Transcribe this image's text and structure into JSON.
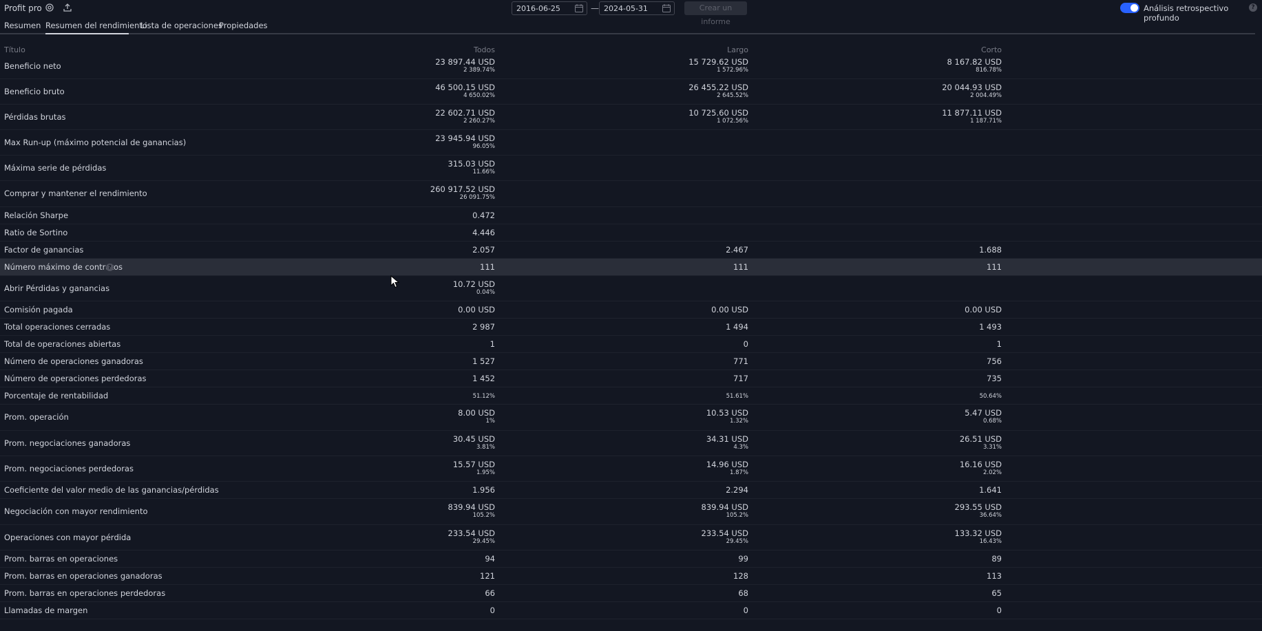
{
  "header": {
    "title": "Profit pro",
    "start_date": "2016-06-25",
    "end_date": "2024-05-31",
    "date_separator": "—",
    "create_report": "Crear un informe",
    "deep_backtest_label": "Análisis retrospectivo profundo",
    "deep_backtest_on": true
  },
  "tabs": [
    "Resumen",
    "Resumen del rendimiento",
    "Lista de operaciones",
    "Propiedades"
  ],
  "active_tab": "Resumen del rendimiento",
  "columns": {
    "title": "Título",
    "all": "Todos",
    "long": "Largo",
    "short": "Corto"
  },
  "rows": [
    {
      "label": "Beneficio neto",
      "all": [
        "23 897.44 USD",
        "2 389.74%"
      ],
      "long": [
        "15 729.62 USD",
        "1 572.96%"
      ],
      "short": [
        "8 167.82 USD",
        "816.78%"
      ]
    },
    {
      "label": "Beneficio bruto",
      "all": [
        "46 500.15 USD",
        "4 650.02%"
      ],
      "long": [
        "26 455.22 USD",
        "2 645.52%"
      ],
      "short": [
        "20 044.93 USD",
        "2 004.49%"
      ]
    },
    {
      "label": "Pérdidas brutas",
      "all": [
        "22 602.71 USD",
        "2 260.27%"
      ],
      "long": [
        "10 725.60 USD",
        "1 072.56%"
      ],
      "short": [
        "11 877.11 USD",
        "1 187.71%"
      ]
    },
    {
      "label": "Max Run-up (máximo potencial de ganancias)",
      "all": [
        "23 945.94 USD",
        "96.05%"
      ],
      "long": [],
      "short": []
    },
    {
      "label": "Máxima serie de pérdidas",
      "all": [
        "315.03 USD",
        "11.66%"
      ],
      "long": [],
      "short": []
    },
    {
      "label": "Comprar y mantener el rendimiento",
      "all": [
        "260 917.52 USD",
        "26 091.75%"
      ],
      "long": [],
      "short": []
    },
    {
      "label": "Relación Sharpe",
      "all": [
        "0.472"
      ],
      "long": [],
      "short": []
    },
    {
      "label": "Ratio de Sortino",
      "all": [
        "4.446"
      ],
      "long": [],
      "short": []
    },
    {
      "label": "Factor de ganancias",
      "all": [
        "2.057"
      ],
      "long": [
        "2.467"
      ],
      "short": [
        "1.688"
      ]
    },
    {
      "label": "Número máximo de contratos",
      "all": [
        "111"
      ],
      "long": [
        "111"
      ],
      "short": [
        "111"
      ],
      "help": true,
      "highlight": true
    },
    {
      "label": "Abrir Pérdidas y ganancias",
      "all": [
        "10.72 USD",
        "0.04%"
      ],
      "long": [],
      "short": []
    },
    {
      "label": "Comisión pagada",
      "all": [
        "0.00 USD"
      ],
      "long": [
        "0.00 USD"
      ],
      "short": [
        "0.00 USD"
      ]
    },
    {
      "label": "Total operaciones cerradas",
      "all": [
        "2 987"
      ],
      "long": [
        "1 494"
      ],
      "short": [
        "1 493"
      ]
    },
    {
      "label": "Total de operaciones abiertas",
      "all": [
        "1"
      ],
      "long": [
        "0"
      ],
      "short": [
        "1"
      ]
    },
    {
      "label": "Número de operaciones ganadoras",
      "all": [
        "1 527"
      ],
      "long": [
        "771"
      ],
      "short": [
        "756"
      ]
    },
    {
      "label": "Número de operaciones perdedoras",
      "all": [
        "1 452"
      ],
      "long": [
        "717"
      ],
      "short": [
        "735"
      ]
    },
    {
      "label": "Porcentaje de rentabilidad",
      "all": [
        "",
        "51.12%"
      ],
      "long": [
        "",
        "51.61%"
      ],
      "short": [
        "",
        "50.64%"
      ]
    },
    {
      "label": "Prom. operación",
      "all": [
        "8.00 USD",
        "1%"
      ],
      "long": [
        "10.53 USD",
        "1.32%"
      ],
      "short": [
        "5.47 USD",
        "0.68%"
      ]
    },
    {
      "label": "Prom. negociaciones ganadoras",
      "all": [
        "30.45 USD",
        "3.81%"
      ],
      "long": [
        "34.31 USD",
        "4.3%"
      ],
      "short": [
        "26.51 USD",
        "3.31%"
      ]
    },
    {
      "label": "Prom. negociaciones perdedoras",
      "all": [
        "15.57 USD",
        "1.95%"
      ],
      "long": [
        "14.96 USD",
        "1.87%"
      ],
      "short": [
        "16.16 USD",
        "2.02%"
      ]
    },
    {
      "label": "Coeficiente del valor medio de las ganancias/pérdidas",
      "all": [
        "1.956"
      ],
      "long": [
        "2.294"
      ],
      "short": [
        "1.641"
      ]
    },
    {
      "label": "Negociación con mayor rendimiento",
      "all": [
        "839.94 USD",
        "105.2%"
      ],
      "long": [
        "839.94 USD",
        "105.2%"
      ],
      "short": [
        "293.55 USD",
        "36.64%"
      ]
    },
    {
      "label": "Operaciones con mayor pérdida",
      "all": [
        "233.54 USD",
        "29.45%"
      ],
      "long": [
        "233.54 USD",
        "29.45%"
      ],
      "short": [
        "133.32 USD",
        "16.43%"
      ]
    },
    {
      "label": "Prom. barras en operaciones",
      "all": [
        "94"
      ],
      "long": [
        "99"
      ],
      "short": [
        "89"
      ]
    },
    {
      "label": "Prom. barras en operaciones ganadoras",
      "all": [
        "121"
      ],
      "long": [
        "128"
      ],
      "short": [
        "113"
      ]
    },
    {
      "label": "Prom. barras en operaciones perdedoras",
      "all": [
        "66"
      ],
      "long": [
        "68"
      ],
      "short": [
        "65"
      ]
    },
    {
      "label": "Llamadas de margen",
      "all": [
        "0"
      ],
      "long": [
        "0"
      ],
      "short": [
        "0"
      ]
    }
  ]
}
